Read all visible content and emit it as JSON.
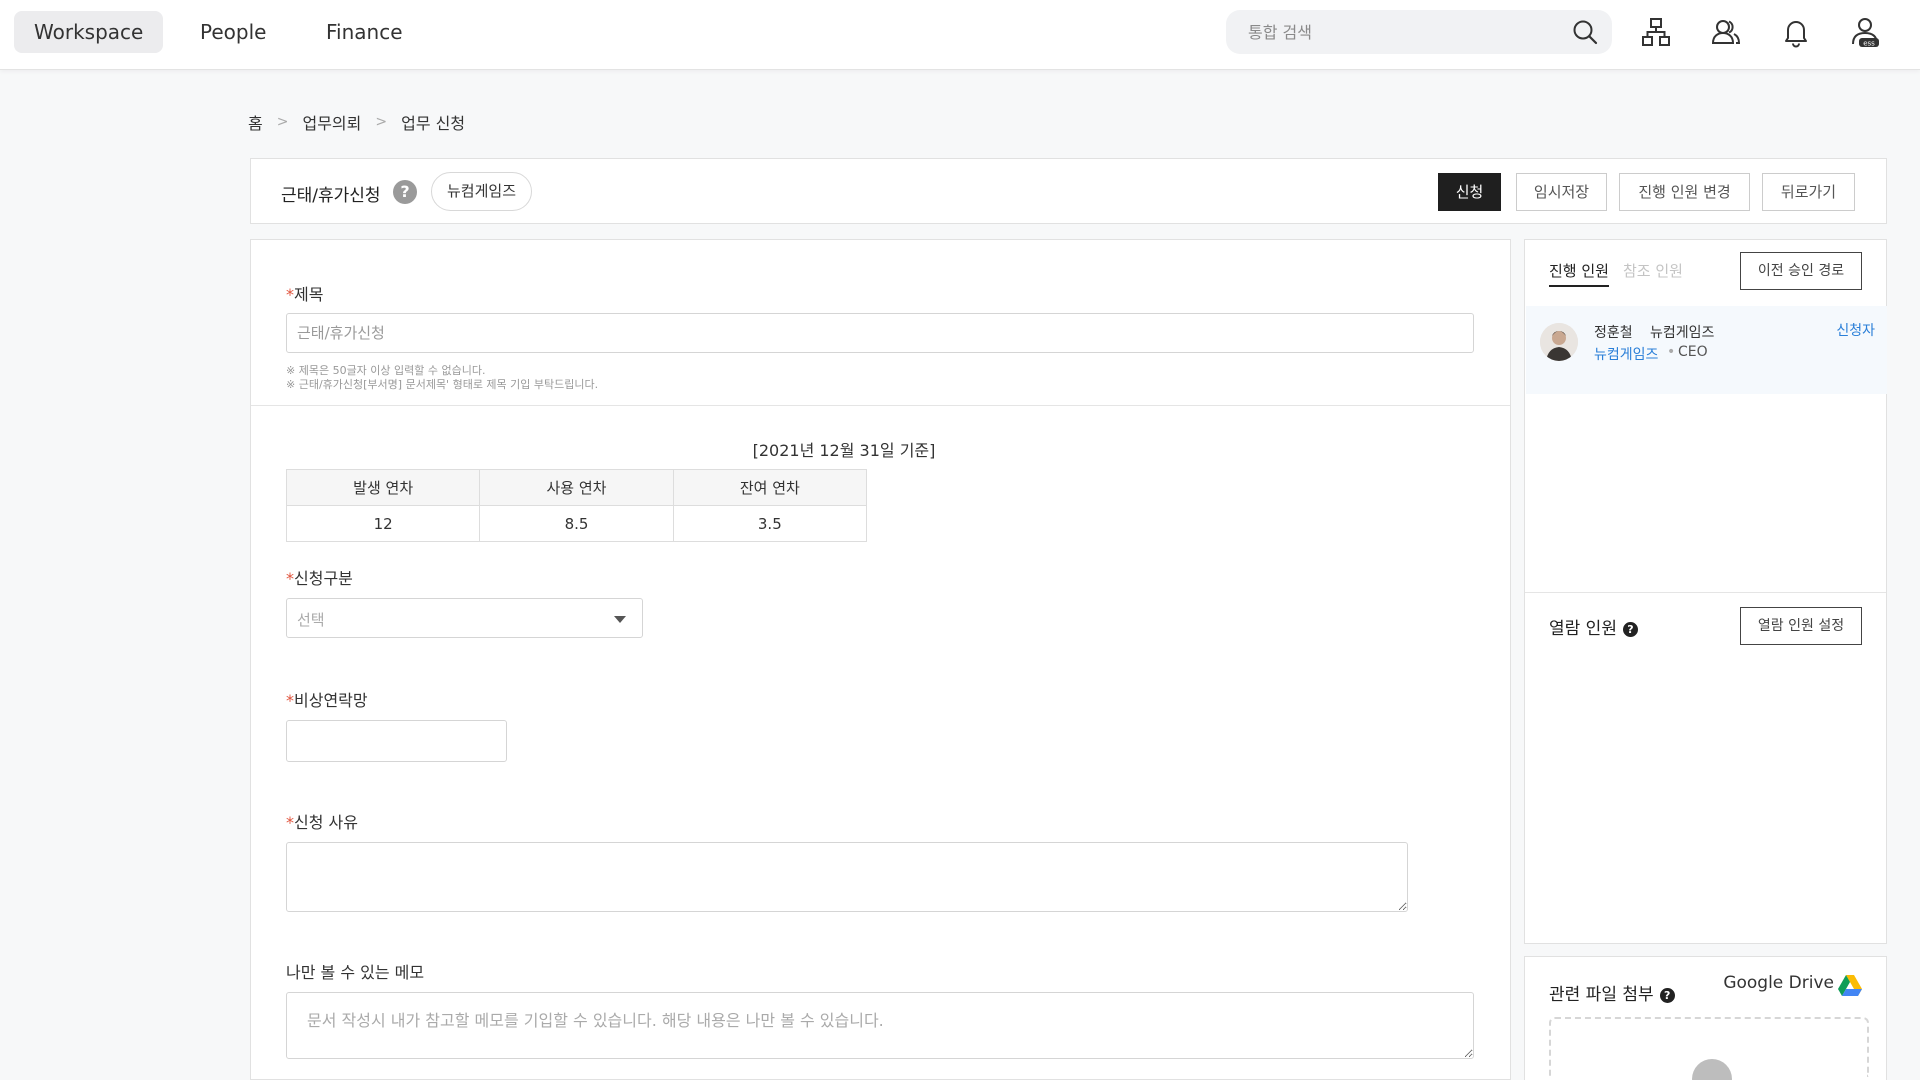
{
  "nav": {
    "tabs": [
      {
        "label": "Workspace",
        "active": true
      },
      {
        "label": "People",
        "active": false
      },
      {
        "label": "Finance",
        "active": false
      }
    ],
    "search_placeholder": "통합 검색",
    "icons": [
      "search-icon",
      "org-chart-icon",
      "contacts-icon",
      "bell-icon",
      "ess-profile-icon"
    ]
  },
  "breadcrumb": {
    "items": [
      "홈",
      "업무의뢰",
      "업무 신청"
    ],
    "separator": ">"
  },
  "header": {
    "form_title": "근태/휴가신청",
    "help": "?",
    "company_chip": "뉴컴게임즈",
    "buttons": {
      "submit": "신청",
      "save_draft": "임시저장",
      "change_approvers": "진행 인원 변경",
      "back": "뒤로가기"
    }
  },
  "form": {
    "required_mark": "*",
    "title_field": {
      "label": "제목",
      "placeholder": "근태/휴가신청",
      "notes": [
        "※ 제목은 50글자 이상 입력할 수 없습니다.",
        "※ 근태/휴가신청[부서명] 문서제목' 형태로 제목 기입 부탁드립니다."
      ]
    },
    "leave_summary": {
      "basis_label": "[2021년 12월 31일 기준]",
      "headers": [
        "발생 연차",
        "사용 연차",
        "잔여 연차"
      ],
      "values": [
        "12",
        "8.5",
        "3.5"
      ]
    },
    "category": {
      "label": "신청구분",
      "selected": "선택"
    },
    "emergency_contact": {
      "label": "비상연락망",
      "value": ""
    },
    "reason": {
      "label": "신청 사유",
      "value": ""
    },
    "private_memo": {
      "label": "나만 볼 수 있는 메모",
      "placeholder": "문서 작성시 내가 참고할 메모를 기입할 수 있습니다. 해당 내용은 나만 볼 수 있습니다."
    }
  },
  "side": {
    "approvers": {
      "tabs": [
        {
          "label": "진행 인원",
          "active": true
        },
        {
          "label": "참조 인원",
          "active": false
        }
      ],
      "prev_route_button": "이전 승인 경로",
      "list": [
        {
          "name": "정훈철",
          "company": "뉴컴게임즈",
          "company_link": "뉴컴게임즈",
          "separator": "•",
          "role": "CEO",
          "tag": "신청자"
        }
      ]
    },
    "viewers": {
      "heading": "열람 인원",
      "help": "?",
      "settings_button": "열람 인원 설정"
    },
    "attachments": {
      "heading": "관련 파일 첨부",
      "help": "?",
      "drive_label": "Google Drive"
    }
  },
  "colors": {
    "required": "#e0533c",
    "link_blue": "#2a7fd8",
    "primary_button": "#1f1f1f",
    "active_nav_bg": "#ececee"
  }
}
